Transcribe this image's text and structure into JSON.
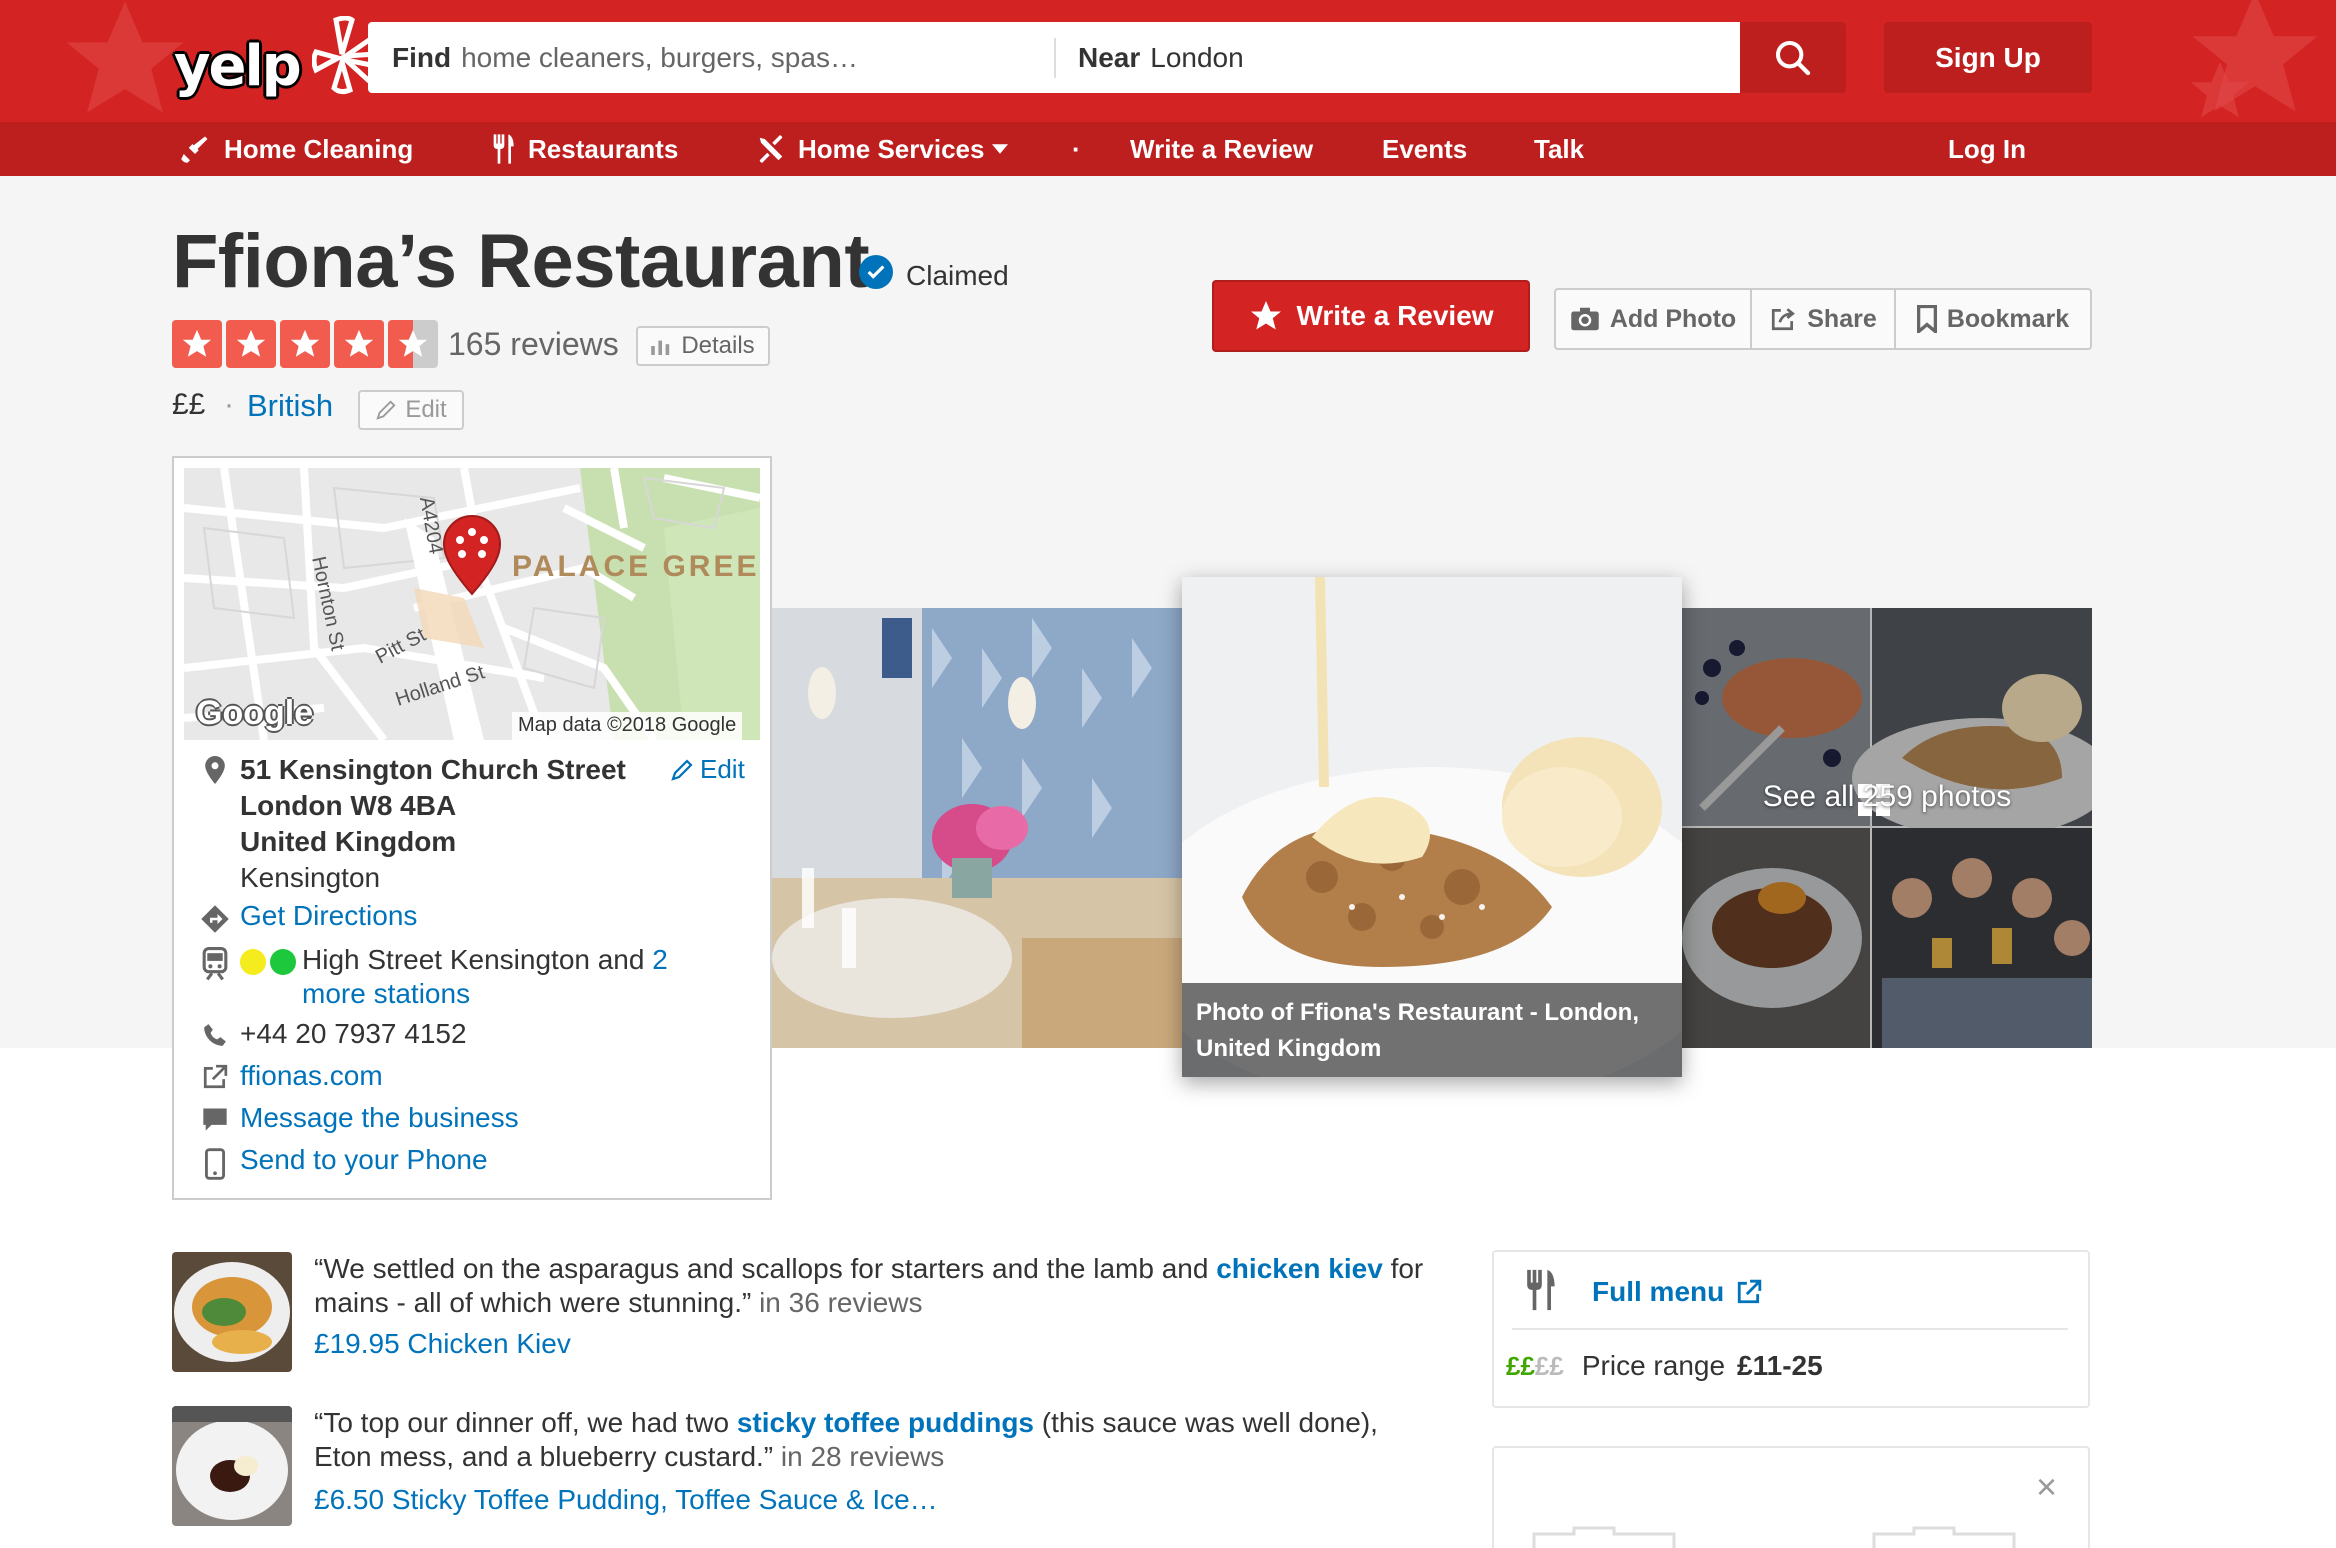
{
  "header": {
    "logo_text": "yelp",
    "search_find_label": "Find",
    "search_find_placeholder": "home cleaners, burgers, spas…",
    "search_near_label": "Near",
    "search_near_value": "London",
    "signup_label": "Sign Up"
  },
  "nav": {
    "items": [
      {
        "label": "Home Cleaning",
        "icon": "broom-icon"
      },
      {
        "label": "Restaurants",
        "icon": "fork-knife-icon"
      },
      {
        "label": "Home Services",
        "icon": "tools-icon"
      },
      {
        "label": "Write a Review"
      },
      {
        "label": "Events"
      },
      {
        "label": "Talk"
      }
    ],
    "login_label": "Log In"
  },
  "business": {
    "name": "Ffiona’s Restaurant",
    "claimed_label": "Claimed",
    "rating": 4.5,
    "review_count": "165 reviews",
    "details_label": "Details",
    "price": "££",
    "separator": "·",
    "category": "British",
    "edit_label": "Edit"
  },
  "actions": {
    "write_review": "Write a Review",
    "add_photo": "Add Photo",
    "share": "Share",
    "bookmark": "Bookmark"
  },
  "map": {
    "labels": [
      "PALACE GREEN",
      "A4204",
      "Hornton St",
      "Pitt St",
      "Holland St"
    ],
    "logo": "Google",
    "credit": "Map data ©2018 Google"
  },
  "info": {
    "address_line1": "51 Kensington Church Street",
    "address_line2": "London W8 4BA",
    "address_line3": "United Kingdom",
    "neighborhood": "Kensington",
    "edit_label": "Edit",
    "directions": "Get Directions",
    "transit_text": "High Street Kensington and",
    "transit_count": "2",
    "transit_more": "more stations",
    "transit_colors": [
      "#f5ec1e",
      "#1ec83c"
    ],
    "phone": "+44 20 7937 4152",
    "website": "ffionas.com",
    "message": "Message the business",
    "send_phone": "Send to your Phone"
  },
  "photos": {
    "caption": "Photo of Ffiona's Restaurant - London, United Kingdom",
    "see_all": "See all 259 photos"
  },
  "reviews": [
    {
      "quote_start": "“We settled on the asparagus and scallops for starters and the lamb and ",
      "highlight": "chicken kiev",
      "quote_end": " for mains - all of which were stunning.”",
      "meta": " in 36 reviews",
      "dish": "£19.95 Chicken Kiev"
    },
    {
      "quote_start": "“To top our dinner off, we had two ",
      "highlight": "sticky toffee puddings",
      "quote_end": " (this sauce was well done), Eton mess, and a blueberry custard.”",
      "meta": " in 28 reviews",
      "dish": "£6.50 Sticky Toffee Pudding, Toffee Sauce & Ice…"
    }
  ],
  "sidebar": {
    "full_menu": "Full menu",
    "price_symbols_active": "££",
    "price_symbols_inactive": "££",
    "price_range_label": "Price range",
    "price_range_value": "£11-25",
    "close_symbol": "×"
  },
  "colors": {
    "brand_red": "#d32323",
    "nav_red": "#bd1f1f",
    "star_red": "#f15c4f",
    "link_blue": "#0073bb",
    "price_green": "#41a700"
  }
}
